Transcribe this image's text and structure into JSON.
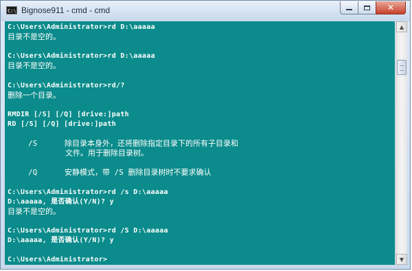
{
  "window": {
    "title": "Bignose911 - cmd - cmd",
    "app_icon_text": "C:\\",
    "controls": {
      "minimize": "minimize",
      "maximize": "maximize",
      "close": "✕"
    }
  },
  "console": {
    "background_color": "#0b8b8b",
    "text_color": "#ffffff",
    "lines": [
      {
        "text": "C:\\Users\\Administrator>rd D:\\aaaaa",
        "kind": "cmd"
      },
      {
        "text": "目录不是空的。",
        "kind": "output"
      },
      {
        "text": "",
        "kind": "blank"
      },
      {
        "text": "C:\\Users\\Administrator>rd D:\\aaaaa",
        "kind": "cmd"
      },
      {
        "text": "目录不是空的。",
        "kind": "output"
      },
      {
        "text": "",
        "kind": "blank"
      },
      {
        "text": "C:\\Users\\Administrator>rd/?",
        "kind": "cmd"
      },
      {
        "text": "删除一个目录。",
        "kind": "output"
      },
      {
        "text": "",
        "kind": "blank"
      },
      {
        "text": "RMDIR [/S] [/Q] [drive:]path",
        "kind": "cmd"
      },
      {
        "text": "RD [/S] [/Q] [drive:]path",
        "kind": "cmd"
      },
      {
        "text": "",
        "kind": "blank"
      },
      {
        "text": "/S      除目录本身外，还将删除指定目录下的所有子目录和",
        "kind": "option"
      },
      {
        "text": "文件。用于删除目录树。",
        "kind": "continuation"
      },
      {
        "text": "",
        "kind": "blank"
      },
      {
        "text": "/Q      安静模式，带 /S 删除目录树时不要求确认",
        "kind": "option"
      },
      {
        "text": "",
        "kind": "blank"
      },
      {
        "text": "C:\\Users\\Administrator>rd /s D:\\aaaaa",
        "kind": "cmd"
      },
      {
        "text": "D:\\aaaaa, 是否确认(Y/N)? y",
        "kind": "cmd"
      },
      {
        "text": "目录不是空的。",
        "kind": "output"
      },
      {
        "text": "",
        "kind": "blank"
      },
      {
        "text": "C:\\Users\\Administrator>rd /S D:\\aaaaa",
        "kind": "cmd"
      },
      {
        "text": "D:\\aaaaa, 是否确认(Y/N)? y",
        "kind": "cmd"
      },
      {
        "text": "",
        "kind": "blank"
      },
      {
        "text": "C:\\Users\\Administrator>",
        "kind": "cmd"
      }
    ]
  },
  "scrollbar": {
    "up_arrow": "▲",
    "down_arrow": "▼"
  }
}
